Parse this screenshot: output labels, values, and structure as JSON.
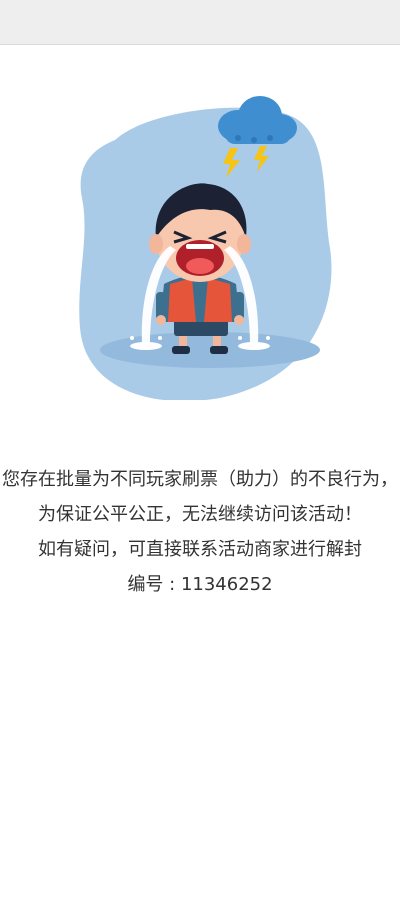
{
  "top_bar": {
    "color": "#eeeeee"
  },
  "illustration": {
    "icon": "crying-boy-storm-cloud-icon",
    "background_color": "#a9cbe8",
    "cloud_color": "#3f8fd0",
    "lightning_color": "#f5c416",
    "shirt_color": "#3d6f8e",
    "vest_color": "#e5553a",
    "tears_color": "#ffffff"
  },
  "message": {
    "lines": [
      "您存在批量为不同玩家刷票（助力）的不良行为，",
      "为保证公平公正，无法继续访问该活动！",
      "如有疑问，可直接联系活动商家进行解封",
      "编号 : 11346252"
    ]
  }
}
